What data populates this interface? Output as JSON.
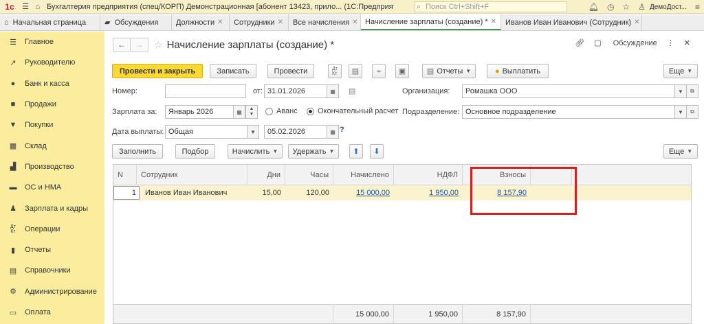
{
  "titlebar": {
    "logo": "1с",
    "title": "Бухгалтерия предприятия (спец/КОРП) Демонстрационная [абонент 13423, прило...  (1С:Предприятие)",
    "search_placeholder": "Поиск Ctrl+Shift+F",
    "user": "ДемоДост..."
  },
  "tabs": [
    {
      "label": "Начальная страница",
      "closable": false
    },
    {
      "label": "Обсуждения",
      "closable": false
    },
    {
      "label": "Должности",
      "closable": true
    },
    {
      "label": "Сотрудники",
      "closable": true
    },
    {
      "label": "Все начисления",
      "closable": true
    },
    {
      "label": "Начисление зарплаты (создание) *",
      "closable": true,
      "active": true
    },
    {
      "label": "Иванов Иван Иванович (Сотрудник)",
      "closable": true
    }
  ],
  "sidebar": {
    "items": [
      {
        "label": "Главное",
        "icon": "menu-icon"
      },
      {
        "label": "Руководителю",
        "icon": "chart-line-icon"
      },
      {
        "label": "Банк и касса",
        "icon": "coin-icon"
      },
      {
        "label": "Продажи",
        "icon": "bag-icon"
      },
      {
        "label": "Покупки",
        "icon": "cart-icon"
      },
      {
        "label": "Склад",
        "icon": "warehouse-icon"
      },
      {
        "label": "Производство",
        "icon": "factory-icon"
      },
      {
        "label": "ОС и НМА",
        "icon": "truck-icon"
      },
      {
        "label": "Зарплата и кадры",
        "icon": "person-icon"
      },
      {
        "label": "Операции",
        "icon": "dt-kt-icon"
      },
      {
        "label": "Отчеты",
        "icon": "bar-chart-icon"
      },
      {
        "label": "Справочники",
        "icon": "book-icon"
      },
      {
        "label": "Администрирование",
        "icon": "gear-icon"
      },
      {
        "label": "Оплата",
        "icon": "card-icon"
      }
    ]
  },
  "form": {
    "title": "Начисление зарплаты (создание) *",
    "discussion": "Обсуждение",
    "buttons": {
      "post_close": "Провести и закрыть",
      "save": "Записать",
      "post": "Провести",
      "reports": "Отчеты",
      "pay": "Выплатить",
      "more": "Еще"
    },
    "fields": {
      "number_label": "Номер:",
      "number_value": "",
      "date_label": "от:",
      "date_value": "31.01.2026",
      "org_label": "Организация:",
      "org_value": "Ромашка ООО",
      "period_label": "Зарплата за:",
      "period_value": "Январь 2026",
      "advance_label": "Аванс",
      "final_label": "Окончательный расчет",
      "dept_label": "Подразделение:",
      "dept_value": "Основное подразделение",
      "paydate_label": "Дата выплаты:",
      "paydate_value": "Общая",
      "paydate_date": "05.02.2026",
      "help": "?"
    },
    "table_toolbar": {
      "fill": "Заполнить",
      "select": "Подбор",
      "accrue": "Начислить",
      "withhold": "Удержать",
      "more": "Еще"
    },
    "table": {
      "columns": [
        "N",
        "Сотрудник",
        "Дни",
        "Часы",
        "Начислено",
        "НДФЛ",
        "Взносы"
      ],
      "rows": [
        {
          "n": "1",
          "employee": "Иванов Иван Иванович",
          "days": "15,00",
          "hours": "120,00",
          "accrued": "15 000,00",
          "ndfl": "1 950,00",
          "contrib": "8 157,90"
        }
      ],
      "totals": {
        "accrued": "15 000,00",
        "ndfl": "1 950,00",
        "contrib": "8 157,90"
      }
    }
  }
}
